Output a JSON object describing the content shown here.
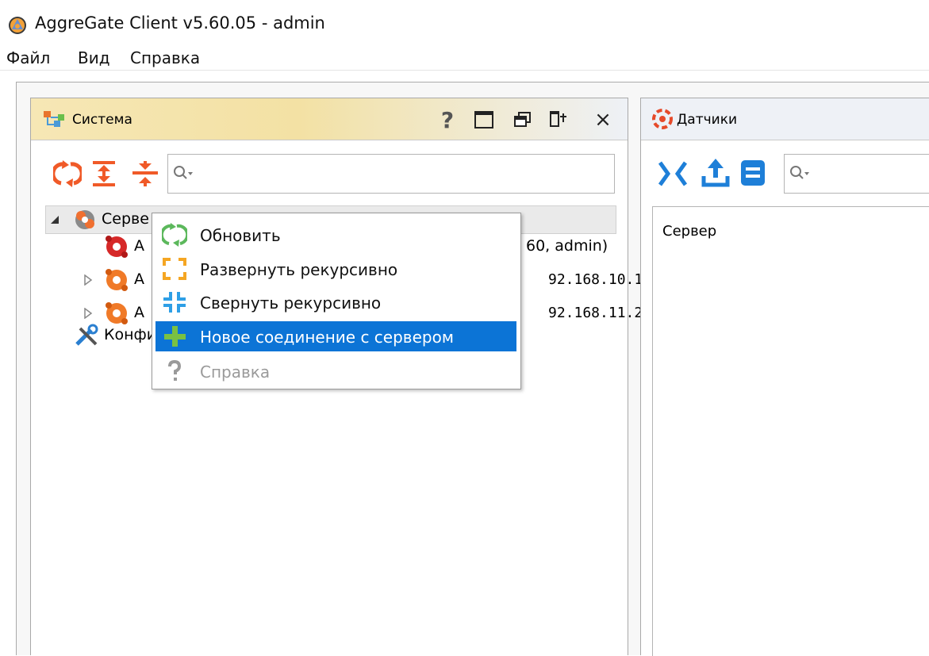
{
  "window": {
    "title": "AggreGate Client v5.60.05 - admin"
  },
  "menu": {
    "items": [
      "Файл",
      "Вид",
      "Справка"
    ]
  },
  "panels": {
    "system": {
      "title": "Система",
      "header_buttons": [
        "help-icon",
        "maximize-icon",
        "restore-icon",
        "pin-icon",
        "close-icon"
      ],
      "close_glyph": "×",
      "help_glyph": "?",
      "search_placeholder": "",
      "tree": {
        "root": {
          "label": "Серве",
          "expanded": true
        },
        "items": [
          {
            "label_left": "А",
            "label_right": "60, admin)"
          },
          {
            "label_left": "А",
            "label_right": "92.168.10.1"
          },
          {
            "label_left": "А",
            "label_right": "92.168.11.2"
          },
          {
            "label_left": "Конфи",
            "label_right": ""
          }
        ]
      }
    },
    "sensors": {
      "title": "Датчики",
      "content_label": "Сервер",
      "search_placeholder": ""
    }
  },
  "context_menu": {
    "items": [
      {
        "label": "Обновить",
        "icon": "refresh-icon",
        "state": "normal"
      },
      {
        "label": "Развернуть рекурсивно",
        "icon": "expand-icon",
        "state": "normal"
      },
      {
        "label": "Свернуть рекурсивно",
        "icon": "collapse-icon",
        "state": "normal"
      },
      {
        "label": "Новое соединение с сервером",
        "icon": "plus-icon",
        "state": "selected"
      },
      {
        "label": "Справка",
        "icon": "help-icon",
        "state": "disabled"
      }
    ]
  },
  "colors": {
    "accent_orange": "#f05a28",
    "accent_blue": "#1e7fd8",
    "selection": "#0c74d6",
    "refresh_green": "#5cb85c"
  }
}
